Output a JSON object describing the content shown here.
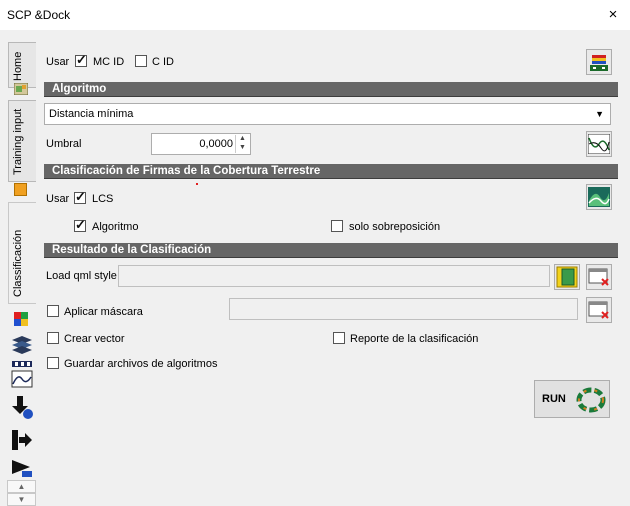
{
  "window": {
    "title": "SCP &Dock",
    "close_glyph": "×"
  },
  "tabs": [
    {
      "label": "Home"
    },
    {
      "label": "Training input"
    },
    {
      "label": "Classificación"
    }
  ],
  "top": {
    "usar_label": "Usar",
    "mc_id_label": "MC ID",
    "mc_id_checked": true,
    "c_id_label": "C ID",
    "c_id_checked": false
  },
  "algoritmo": {
    "header": "Algoritmo",
    "selected": "Distancia mínima",
    "umbral_label": "Umbral",
    "umbral_value": "0,0000"
  },
  "lcs": {
    "header": "Clasificación de Firmas de la Cobertura Terrestre",
    "usar_label": "Usar",
    "lcs_label": "LCS",
    "lcs_checked": true,
    "algoritmo_label": "Algoritmo",
    "algoritmo_checked": true,
    "solo_label": "solo sobreposición",
    "solo_checked": false
  },
  "resultado": {
    "header": "Resultado de la Clasificación",
    "load_qml_label": "Load qml style",
    "aplicar_mascara_label": "Aplicar máscara",
    "crear_vector_label": "Crear vector",
    "reporte_label": "Reporte de la clasificación",
    "guardar_label": "Guardar archivos de algoritmos",
    "run_label": "RUN"
  },
  "colors": {
    "section_bg": "#666666",
    "accent_orange": "#f0a020"
  }
}
